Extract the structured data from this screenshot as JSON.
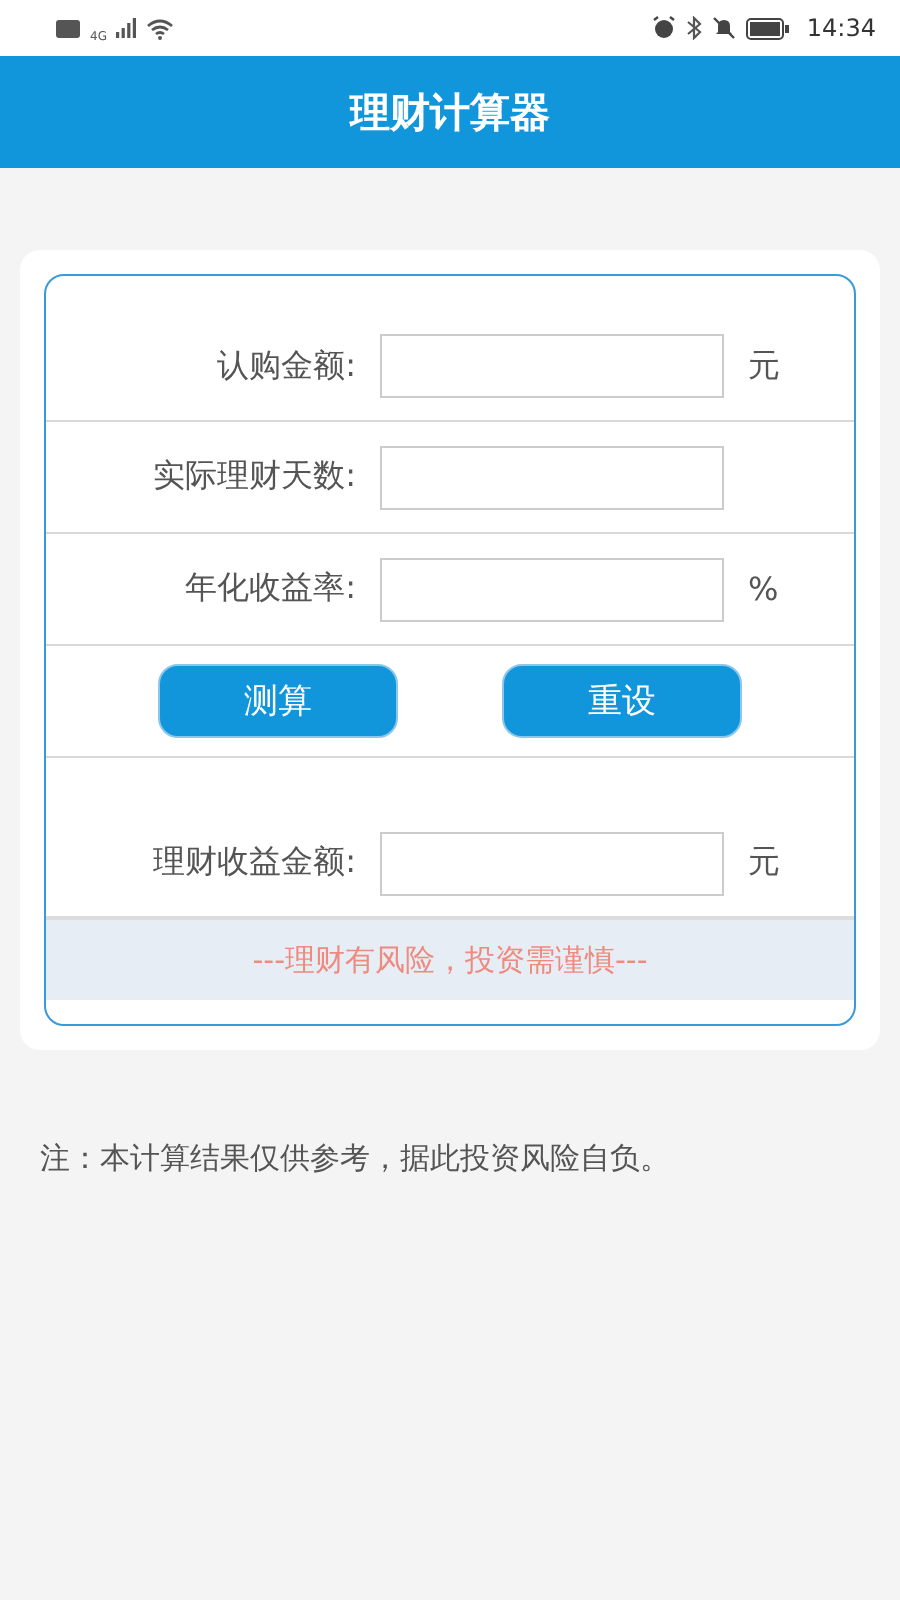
{
  "status_bar": {
    "network": "4G",
    "time": "14:34"
  },
  "header": {
    "title": "理财计算器"
  },
  "rows": [
    {
      "kind": "field",
      "label": "认购金额:",
      "unit": "元"
    },
    {
      "kind": "field",
      "label": "实际理财天数:"
    },
    {
      "kind": "field",
      "label": "年化收益率:",
      "unit": "%"
    },
    {
      "kind": "buttons",
      "buttons": [
        "测算",
        "重设"
      ]
    },
    {
      "kind": "result",
      "label": "理财收益金额:",
      "unit": "元"
    }
  ],
  "warning": "---理财有风险，投资需谨慎---",
  "note": "注：本计算结果仅供参考，据此投资风险自负。"
}
